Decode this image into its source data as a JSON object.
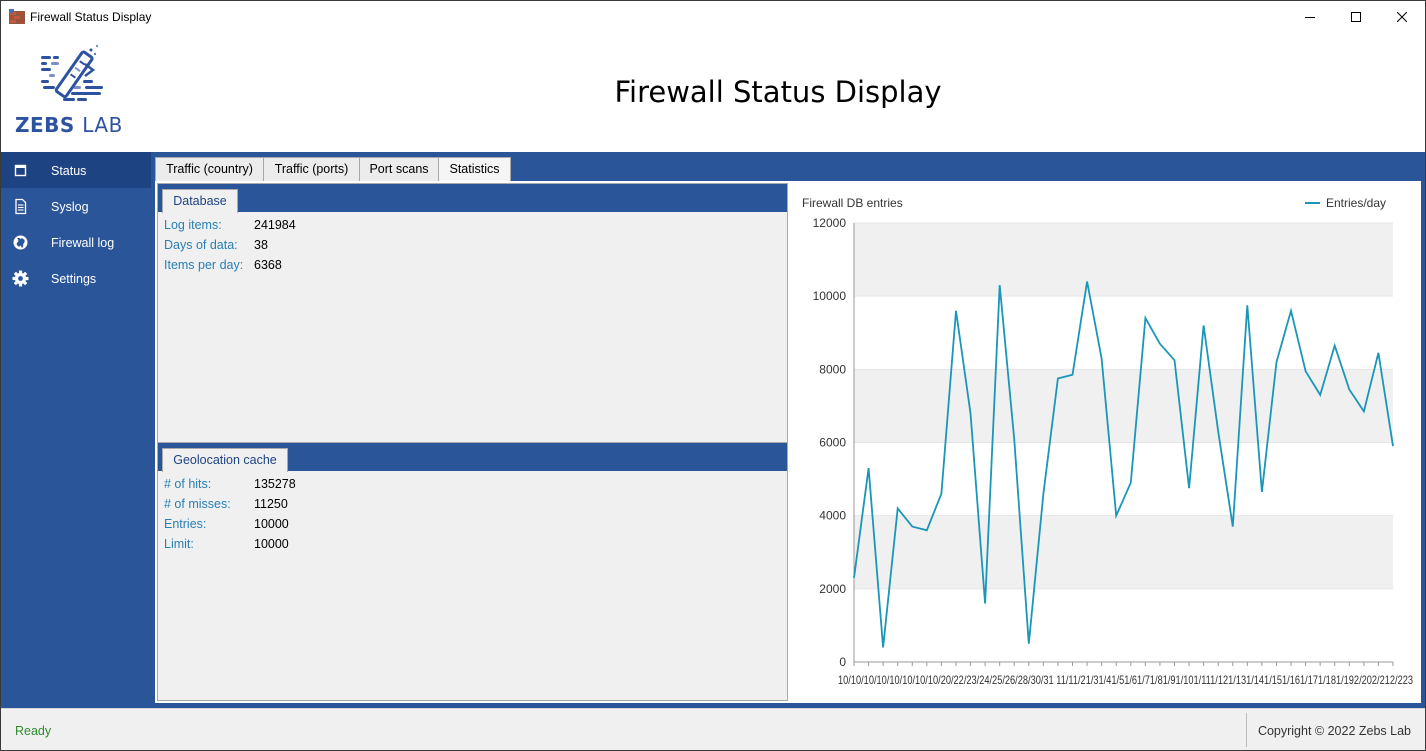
{
  "window": {
    "title": "Firewall Status Display"
  },
  "header": {
    "logo_text": "ZEBS",
    "logo_text_2": "LAB",
    "heading": "Firewall Status Display"
  },
  "sidebar": {
    "items": [
      {
        "label": "Status",
        "icon": "window-icon",
        "active": true
      },
      {
        "label": "Syslog",
        "icon": "document-icon",
        "active": false
      },
      {
        "label": "Firewall log",
        "icon": "globe-icon",
        "active": false
      },
      {
        "label": "Settings",
        "icon": "gear-icon",
        "active": false
      }
    ]
  },
  "tabs": [
    {
      "label": "Traffic (country)",
      "active": false
    },
    {
      "label": "Traffic (ports)",
      "active": false
    },
    {
      "label": "Port scans",
      "active": false
    },
    {
      "label": "Statistics",
      "active": true
    }
  ],
  "database": {
    "tab_label": "Database",
    "rows": [
      {
        "label": "Log items:",
        "value": "241984"
      },
      {
        "label": "Days of data:",
        "value": "38"
      },
      {
        "label": "Items per day:",
        "value": "6368"
      }
    ]
  },
  "geo": {
    "tab_label": "Geolocation cache",
    "rows": [
      {
        "label": "# of hits:",
        "value": "135278"
      },
      {
        "label": "# of misses:",
        "value": "11250"
      },
      {
        "label": "Entries:",
        "value": "10000"
      },
      {
        "label": "Limit:",
        "value": "10000"
      }
    ]
  },
  "status": {
    "text": "Ready",
    "copyright": "Copyright © 2022 Zebs Lab"
  },
  "colors": {
    "accent": "#2a5599",
    "accent_dark": "#1e4382",
    "line": "#1a96b8",
    "status_ok": "#2e8b2e",
    "label_blue": "#2a7fb3"
  },
  "chart_data": {
    "type": "line",
    "title": "Firewall DB entries",
    "xlabel": "",
    "ylabel": "",
    "ylim": [
      0,
      12000
    ],
    "yticks": [
      0,
      2000,
      4000,
      6000,
      8000,
      10000,
      12000
    ],
    "legend_position": "top-right",
    "x": [
      "10/1",
      "10/2",
      "10/3",
      "10/4",
      "10/5",
      "10/6",
      "10/7",
      "10/8",
      "10/9",
      "10/10",
      "10/11",
      "10/12",
      "10/13",
      "10/14",
      "10/15",
      "10/16",
      "10/17",
      "10/18",
      "10/19",
      "10/20",
      "10/21",
      "10/22",
      "10/23",
      "10/24",
      "10/25",
      "10/26",
      "10/27",
      "10/28",
      "10/29",
      "10/30",
      "10/31",
      "11/1",
      "11/2",
      "11/3",
      "11/4",
      "11/5",
      "11/6",
      "11/7"
    ],
    "x_tick_text": "10/10/10/10/10/10/10/10/20/22/23/24/25/26/28/30/31 11/11/21/31/41/51/61/71/81/91/101/111/121/131/141/151/161/171/181/192/202/212/223",
    "series": [
      {
        "name": "Entries/day",
        "values": [
          2300,
          5300,
          400,
          4200,
          3700,
          3600,
          4600,
          9600,
          6800,
          1600,
          10300,
          6100,
          500,
          4600,
          7750,
          7850,
          10400,
          8300,
          4000,
          4900,
          9400,
          8700,
          8250,
          4750,
          9200,
          6300,
          3700,
          9750,
          4650,
          8200,
          9600,
          7950,
          7300,
          8650,
          7450,
          6850,
          8450,
          5900
        ]
      }
    ]
  }
}
